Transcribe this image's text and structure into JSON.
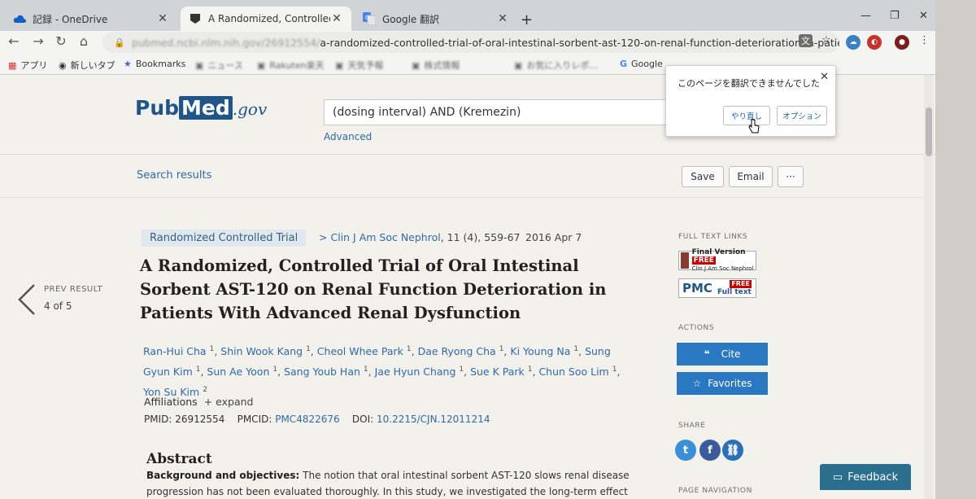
{
  "browser": {
    "tabs": [
      {
        "title": "記録 - OneDrive",
        "active": false
      },
      {
        "title": "A Randomized, Controlled Trial o",
        "active": true
      },
      {
        "title": "Google 翻訳",
        "active": false
      }
    ],
    "url_visible": "pubmed.ncbi.nlm.nih.gov/26912554/",
    "url_tail": "a-randomized-controlled-trial-of-oral-intestinal-sorbent-ast-120-on-renal-function-deterioration-in-patients-with-adv...",
    "bookmarks": [
      {
        "label": "アプリ",
        "icon": "apps-grid-icon"
      },
      {
        "label": "新しいタブ",
        "icon": "chrome-icon"
      },
      {
        "label": "Bookmarks",
        "icon": "star-icon"
      },
      {
        "label": "ニュース",
        "icon": "folder-icon"
      },
      {
        "label": "Rakuten楽天",
        "icon": "folder-icon"
      },
      {
        "label": "天気予報",
        "icon": "folder-icon"
      },
      {
        "label": "株式情報",
        "icon": "folder-icon"
      },
      {
        "label": "お気に入りレポ...",
        "icon": "folder-icon"
      },
      {
        "label": "Google",
        "icon": "google-icon"
      }
    ]
  },
  "translate_popup": {
    "message": "このページを翻訳できませんでした",
    "retry_label": "やり直し",
    "options_label": "オプション"
  },
  "pubmed": {
    "logo_pub": "Pub",
    "logo_med": "Med",
    "logo_gov": ".gov",
    "search_query": "(dosing interval) AND (Kremezin)",
    "advanced_label": "Advanced",
    "search_results_label": "Search results",
    "save_label": "Save",
    "email_label": "Email",
    "more_label": "···"
  },
  "article": {
    "type_badge": "Randomized Controlled Trial",
    "journal_arrow": ">",
    "journal": "Clin J Am Soc Nephrol",
    "journal_rest": ", 11 (4), 559-67",
    "date": "2016 Apr 7",
    "title": "A Randomized, Controlled Trial of Oral Intestinal Sorbent AST-120 on Renal Function Deterioration in Patients With Advanced Renal Dysfunction",
    "authors": [
      {
        "name": "Ran-Hui Cha",
        "sup": "1"
      },
      {
        "name": "Shin Wook Kang",
        "sup": "1"
      },
      {
        "name": "Cheol Whee Park",
        "sup": "1"
      },
      {
        "name": "Dae Ryong Cha",
        "sup": "1"
      },
      {
        "name": "Ki Young Na",
        "sup": "1"
      },
      {
        "name": "Sung Gyun Kim",
        "sup": "1"
      },
      {
        "name": "Sun Ae Yoon",
        "sup": "1"
      },
      {
        "name": "Sang Youb Han",
        "sup": "1"
      },
      {
        "name": "Jae Hyun Chang",
        "sup": "1"
      },
      {
        "name": "Sue K Park",
        "sup": "1"
      },
      {
        "name": "Chun Soo Lim",
        "sup": "1"
      },
      {
        "name": "Yon Su Kim",
        "sup": "2"
      }
    ],
    "affiliations_label": "Affiliations",
    "expand_label": "+ expand",
    "pmid_label": "PMID:",
    "pmid": "26912554",
    "pmcid_label": "PMCID:",
    "pmcid": "PMC4822676",
    "doi_label": "DOI:",
    "doi": "10.2215/CJN.12011214",
    "abstract_heading": "Abstract",
    "abstract_bold": "Background and objectives:",
    "abstract_text": " The notion that oral intestinal sorbent AST-120 slows renal disease progression has not been evaluated thoroughly. In this study, we investigated the long-term effect of"
  },
  "navigation": {
    "prev_label": "PREV RESULT",
    "count": "4 of 5"
  },
  "sidebar": {
    "full_text_label": "FULL TEXT LINKS",
    "final_version": "Final Version",
    "free": "FREE",
    "journal_small": "Clin J Am Soc Nephrol",
    "pmc": "PMC",
    "full_text": "Full text",
    "actions_label": "ACTIONS",
    "cite_label": "Cite",
    "favorites_label": "Favorites",
    "share_label": "SHARE",
    "page_nav_label": "PAGE NAVIGATION",
    "feedback_label": "Feedback"
  },
  "colors": {
    "pubmed_blue": "#20558a",
    "link_blue": "#2f6aa7",
    "button_blue": "#2b78c2",
    "feedback_teal": "#2b6f8f"
  }
}
